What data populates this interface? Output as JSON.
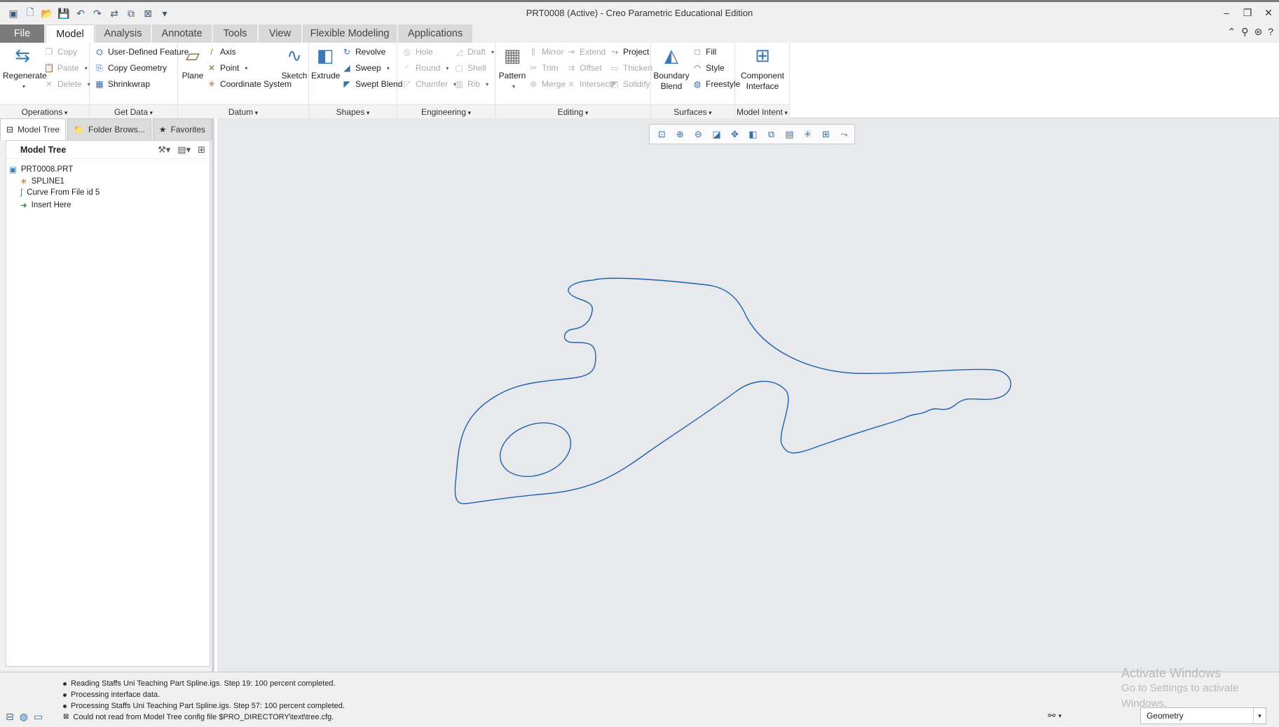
{
  "window": {
    "title": "PRT0008 (Active) - Creo Parametric Educational Edition"
  },
  "tabs": [
    "File",
    "Model",
    "Analysis",
    "Annotate",
    "Tools",
    "View",
    "Flexible Modeling",
    "Applications"
  ],
  "ribbon": {
    "operations": {
      "label": "Operations",
      "regenerate": "Regenerate",
      "copy": "Copy",
      "paste": "Paste",
      "delete": "Delete"
    },
    "get_data": {
      "label": "Get Data",
      "udf": "User-Defined Feature",
      "copy_geometry": "Copy Geometry",
      "shrinkwrap": "Shrinkwrap"
    },
    "datum": {
      "label": "Datum",
      "plane": "Plane",
      "axis": "Axis",
      "point": "Point",
      "csys": "Coordinate System",
      "sketch": "Sketch"
    },
    "shapes": {
      "label": "Shapes",
      "extrude": "Extrude",
      "revolve": "Revolve",
      "sweep": "Sweep",
      "swept_blend": "Swept Blend"
    },
    "engineering": {
      "label": "Engineering",
      "hole": "Hole",
      "round": "Round",
      "chamfer": "Chamfer",
      "draft": "Draft",
      "shell": "Shell",
      "rib": "Rib"
    },
    "editing": {
      "label": "Editing",
      "pattern": "Pattern",
      "mirror": "Mirror",
      "trim": "Trim",
      "merge": "Merge",
      "extend": "Extend",
      "offset": "Offset",
      "intersect": "Intersect",
      "project": "Project",
      "thicken": "Thicken",
      "solidify": "Solidify"
    },
    "surfaces": {
      "label": "Surfaces",
      "boundary_blend": "Boundary Blend",
      "fill": "Fill",
      "style": "Style",
      "freestyle": "Freestyle"
    },
    "model_intent": {
      "label": "Model Intent",
      "component_interface": "Component Interface"
    }
  },
  "panel": {
    "tabs": [
      "Model Tree",
      "Folder Brows...",
      "Favorites"
    ],
    "tree_header": "Model Tree",
    "items": [
      "PRT0008.PRT",
      "SPLINE1",
      "Curve From File id 5",
      "Insert Here"
    ]
  },
  "status": {
    "messages": [
      "Reading Staffs Uni Teaching Part Spline.igs. Step 19:  100 percent completed.",
      "Processing interface data.",
      "Processing Staffs Uni Teaching Part Spline.igs. Step 57:  100 percent completed.",
      "Could not read from Model Tree config file $PRO_DIRECTORY\\text\\tree.cfg."
    ],
    "filter": "Geometry"
  },
  "watermark": {
    "line1": "Activate Windows",
    "line2": "Go to Settings to activate Windows."
  },
  "colors": {
    "curve": "#1f5fae",
    "canvas": "#e7e9ed"
  }
}
